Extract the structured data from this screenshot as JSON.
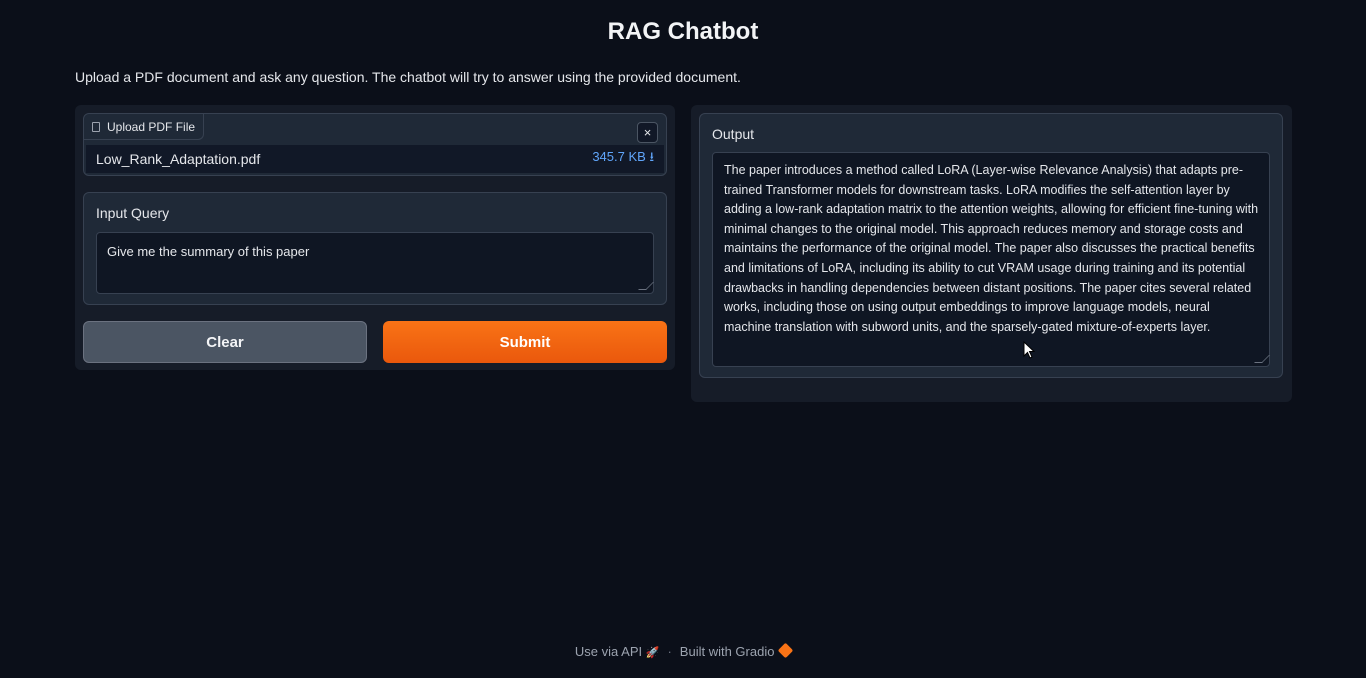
{
  "app": {
    "title": "RAG Chatbot",
    "description": "Upload a PDF document and ask any question. The chatbot will try to answer using the provided document."
  },
  "file_upload": {
    "label": "Upload PDF File",
    "file_name": "Low_Rank_Adaptation.pdf",
    "file_size": "345.7 KB",
    "download_glyph": "⭳",
    "close_glyph": "×"
  },
  "query": {
    "label": "Input Query",
    "value": "Give me the summary of this paper"
  },
  "buttons": {
    "clear_label": "Clear",
    "submit_label": "Submit"
  },
  "output": {
    "label": "Output",
    "value": " The paper introduces a method called LoRA (Layer-wise Relevance Analysis) that adapts pre-trained Transformer models for downstream tasks. LoRA modifies the self-attention layer by adding a low-rank adaptation matrix to the attention weights, allowing for efficient fine-tuning with minimal changes to the original model. This approach reduces memory and storage costs and maintains the performance of the original model. The paper also discusses the practical benefits and limitations of LoRA, including its ability to cut VRAM usage during training and its potential drawbacks in handling dependencies between distant positions. The paper cites several related works, including those on using output embeddings to improve language models, neural machine translation with subword units, and the sparsely-gated mixture-of-experts layer."
  },
  "footer": {
    "api_label": "Use via API",
    "separator": "·",
    "built_label": "Built with Gradio",
    "icons": [
      "rocket-icon",
      "gradio-logo-icon"
    ]
  },
  "colors": {
    "background": "#0b0f19",
    "accent": "#f97316",
    "file_size": "#60a5fa"
  }
}
